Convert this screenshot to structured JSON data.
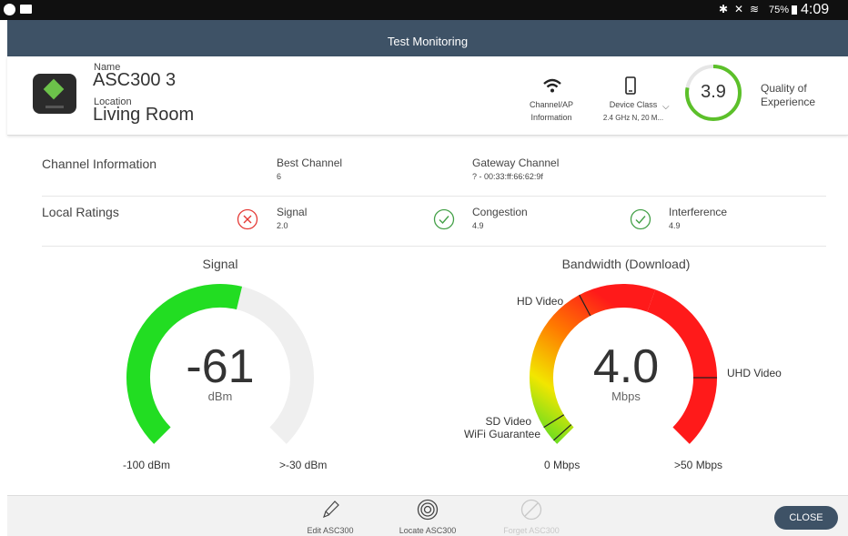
{
  "status_bar": {
    "battery": "75%",
    "time": "4:09 PM"
  },
  "title": "Test Monitoring",
  "device": {
    "name_label": "Name",
    "name": "ASC300 3",
    "location_label": "Location",
    "location": "Living Room"
  },
  "header_actions": {
    "channel_ap_line1": "Channel/AP",
    "channel_ap_line2": "Information",
    "device_class_label": "Device Class",
    "device_class_value": "2.4 GHz N, 20 M..."
  },
  "qoe": {
    "score": "3.9",
    "label_line1": "Quality of",
    "label_line2": "Experience",
    "fraction": 0.78,
    "color": "#5cc02a"
  },
  "channel_info": {
    "title": "Channel Information",
    "best_label": "Best Channel",
    "best_value": "6",
    "gateway_label": "Gateway Channel",
    "gateway_value": "? - 00:33:ff:66:62:9f"
  },
  "local_ratings": {
    "title": "Local Ratings",
    "items": [
      {
        "label": "Signal",
        "value": "2.0",
        "status": "bad",
        "color": "#e53935"
      },
      {
        "label": "Congestion",
        "value": "4.9",
        "status": "good",
        "color": "#43a047"
      },
      {
        "label": "Interference",
        "value": "4.9",
        "status": "good",
        "color": "#43a047"
      }
    ]
  },
  "signal_gauge": {
    "title": "Signal",
    "value": "-61",
    "unit": "dBm",
    "min_label": "-100 dBm",
    "max_label": ">-30 dBm",
    "fraction": 0.55,
    "fill_color": "#22dd22",
    "track_color": "#efefef"
  },
  "bandwidth_gauge": {
    "title": "Bandwidth (Download)",
    "value": "4.0",
    "unit": "Mbps",
    "min_label": "0 Mbps",
    "max_label": ">50 Mbps",
    "markers": {
      "hd": "HD Video",
      "uhd": "UHD Video",
      "sd_line1": "SD Video",
      "sd_line2": "WiFi Guarantee"
    }
  },
  "footer": {
    "edit_label": "Edit ASC300",
    "locate_label": "Locate ASC300",
    "forget_label": "Forget ASC300",
    "close_label": "CLOSE"
  }
}
